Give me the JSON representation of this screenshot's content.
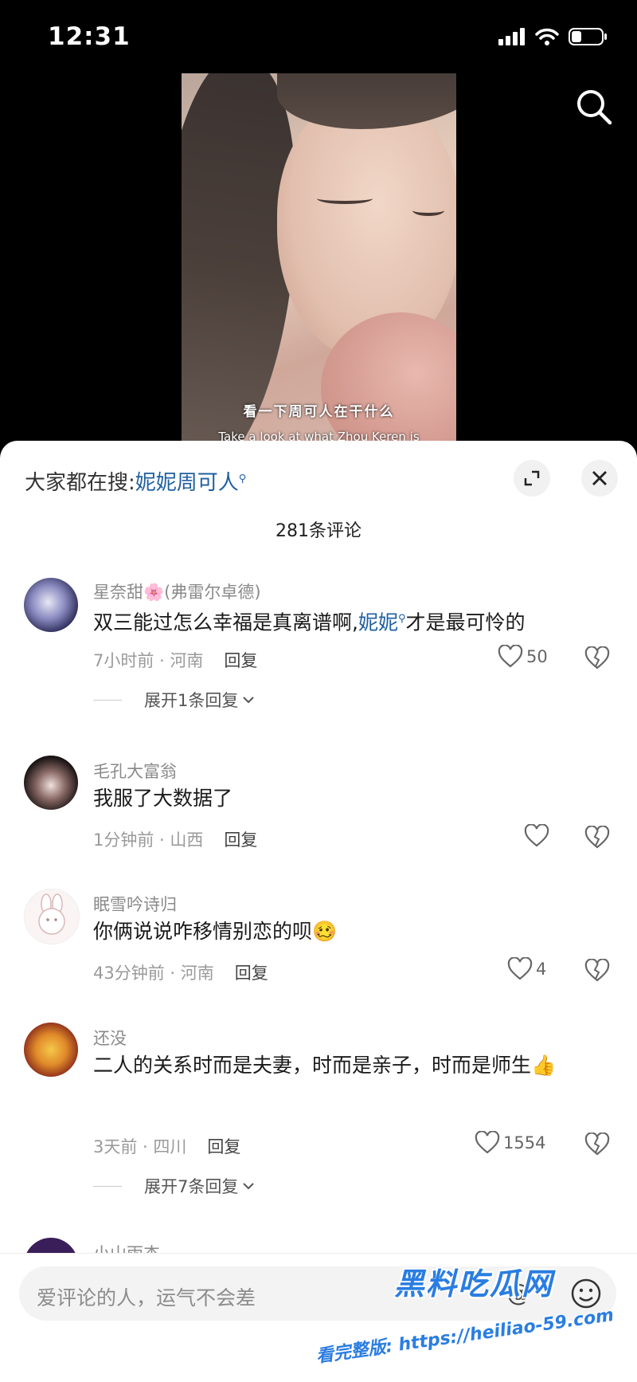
{
  "status_bar": {
    "time": "12:31"
  },
  "video": {
    "subtitle_cn": "看一下周可人在干什么",
    "subtitle_en": "Take a look at what Zhou Keren is"
  },
  "sheet": {
    "hot_search_prefix": "大家都在搜:",
    "hot_search_keyword": "妮妮周可人",
    "comment_count": "281条评论"
  },
  "comments": [
    {
      "username": "星奈甜🌸(弗雷尔卓德)",
      "text_before": "双三能过怎么幸福是真离谱啊,",
      "keyword": "妮妮",
      "text_after": "才是最可怜的",
      "meta": "7小时前 · 河南",
      "reply": "回复",
      "likes": "50",
      "expand": "展开1条回复"
    },
    {
      "username": "毛孔大富翁",
      "text": "我服了大数据了",
      "meta": "1分钟前 · 山西",
      "reply": "回复",
      "likes": ""
    },
    {
      "username": "眠雪吟诗归",
      "text": "你俩说说咋移情别恋的呗🥴",
      "meta": "43分钟前 · 河南",
      "reply": "回复",
      "likes": "4"
    },
    {
      "username": "还没",
      "text": "二人的关系时而是夫妻，时而是亲子，时而是师生👍",
      "meta": "3天前 · 四川",
      "reply": "回复",
      "likes": "1554",
      "expand": "展开7条回复"
    },
    {
      "username": "小山雨杰"
    }
  ],
  "input": {
    "placeholder": "爱评论的人，运气不会差"
  },
  "watermark": {
    "logo": "黑料吃瓜网",
    "url": "看完整版: https://heiliao-59.com"
  },
  "colors": {
    "keyword": "#1f5fa0",
    "watermark": "#2a7de1"
  },
  "icons": [
    "signal-icon",
    "wifi-icon",
    "battery-icon",
    "search-icon",
    "expand-icon",
    "close-icon",
    "heart-icon",
    "dislike-icon",
    "chevron-down-icon",
    "at-icon",
    "emoji-icon"
  ]
}
